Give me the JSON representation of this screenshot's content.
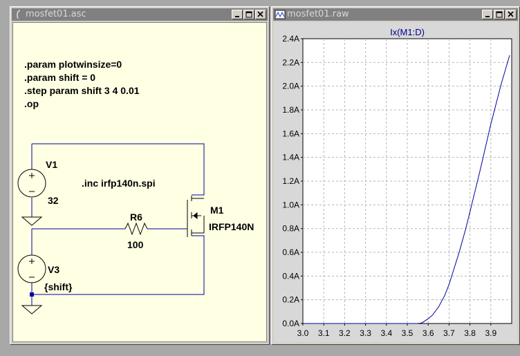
{
  "schematic_window": {
    "title": "mosfet01.asc",
    "directives": [
      ".param plotwinsize=0",
      ".param shift = 0",
      ".step param shift 3 4 0.01",
      ".op"
    ],
    "include": ".inc irfp140n.spi",
    "v1": {
      "name": "V1",
      "value": "32"
    },
    "v3": {
      "name": "V3",
      "value": "{shift}"
    },
    "r6": {
      "name": "R6",
      "value": "100"
    },
    "m1": {
      "name": "M1",
      "value": "IRFP140N"
    }
  },
  "plot_window": {
    "title": "mosfet01.raw"
  },
  "colors": {
    "wire": "#0000a0",
    "trace": "#0000a0",
    "grid": "#b4b4b4",
    "title_inactive": "#808080"
  },
  "chart_data": {
    "type": "line",
    "title": "Ix(M1:D)",
    "xlim": [
      3.0,
      4.0
    ],
    "ylim": [
      0.0,
      2.4
    ],
    "x_ticks": [
      "3.0",
      "3.1",
      "3.2",
      "3.3",
      "3.4",
      "3.5",
      "3.6",
      "3.7",
      "3.8",
      "3.9"
    ],
    "y_ticks": [
      "0.0A",
      "0.2A",
      "0.4A",
      "0.6A",
      "0.8A",
      "1.0A",
      "1.2A",
      "1.4A",
      "1.6A",
      "1.8A",
      "2.0A",
      "2.2A",
      "2.4A"
    ],
    "grid": true,
    "series": [
      {
        "name": "Ix(M1:D)",
        "x": [
          3.0,
          3.1,
          3.2,
          3.3,
          3.4,
          3.5,
          3.55,
          3.57,
          3.6,
          3.62,
          3.65,
          3.68,
          3.7,
          3.72,
          3.75,
          3.78,
          3.8,
          3.85,
          3.9,
          3.95,
          3.99
        ],
        "y": [
          0,
          0,
          0,
          0,
          0,
          0,
          0,
          0.005,
          0.04,
          0.07,
          0.14,
          0.24,
          0.33,
          0.44,
          0.61,
          0.8,
          0.94,
          1.3,
          1.68,
          2.02,
          2.26
        ]
      }
    ]
  }
}
